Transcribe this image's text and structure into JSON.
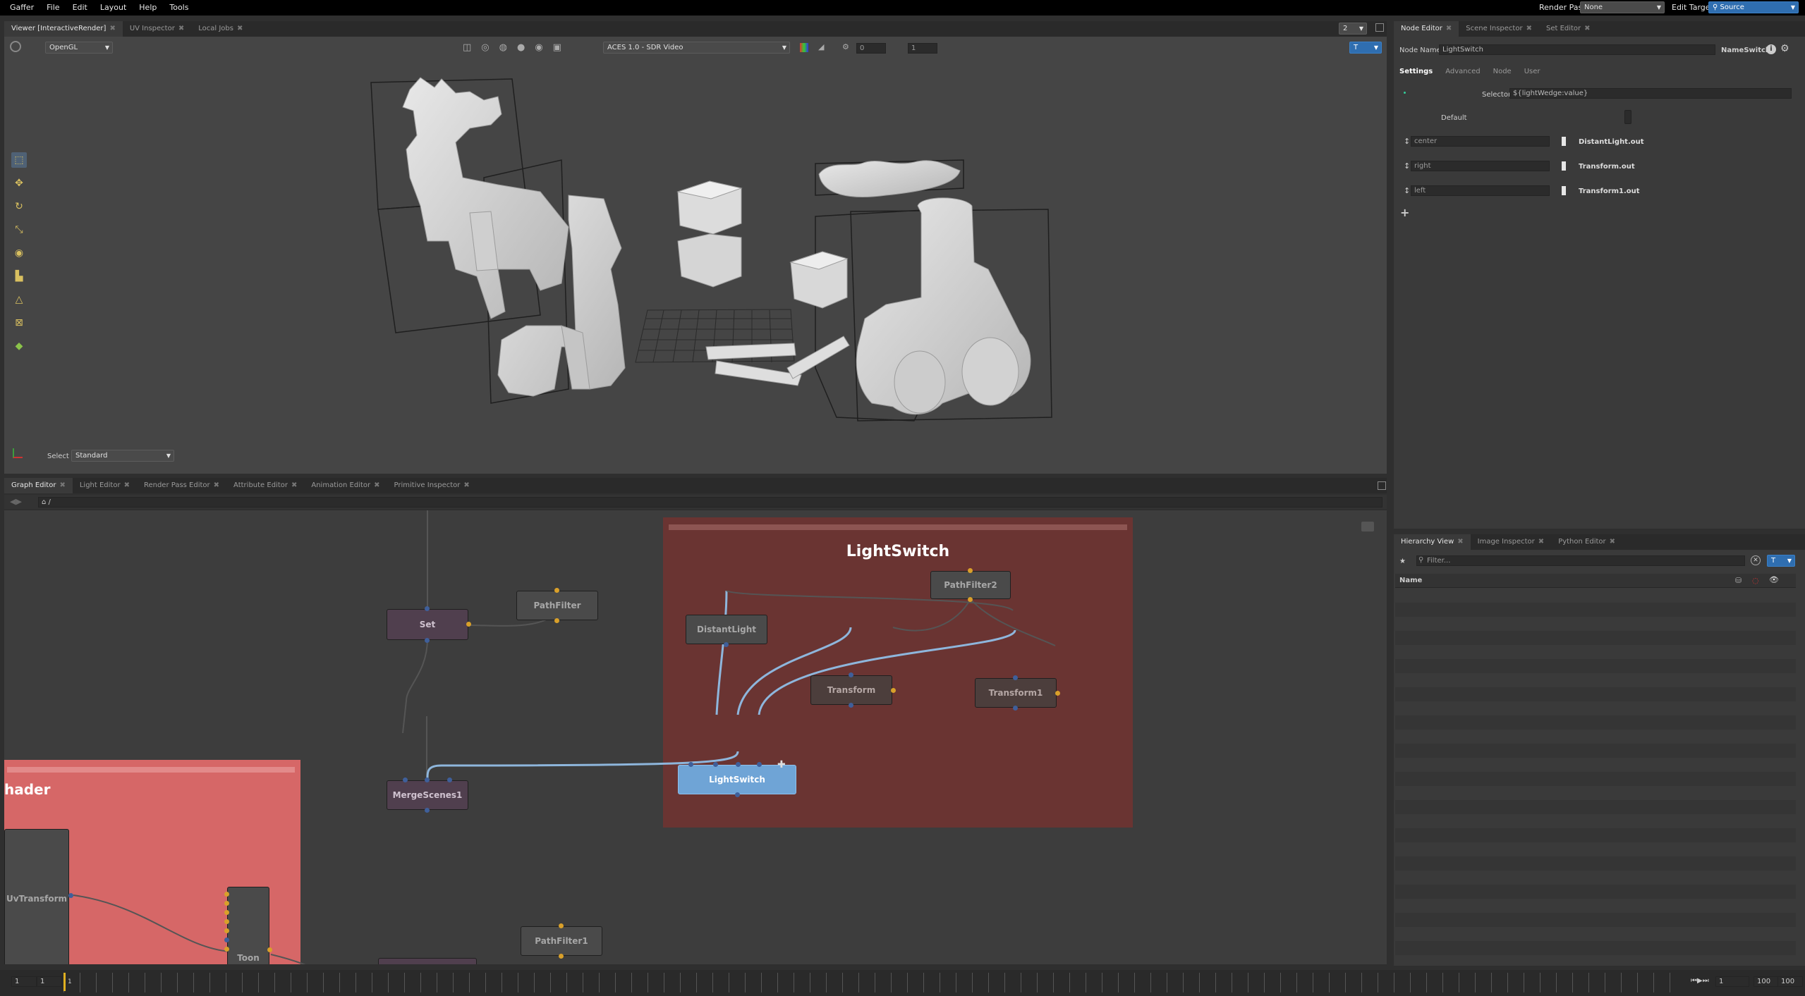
{
  "menubar": {
    "items": [
      "Gaffer",
      "File",
      "Edit",
      "Layout",
      "Help",
      "Tools"
    ],
    "render_pass_label": "Render Pass",
    "render_pass_value": "None",
    "edit_target_label": "Edit Target",
    "edit_target_value": "Source"
  },
  "viewer": {
    "tabs": [
      {
        "label": "Viewer [InteractiveRender]",
        "active": true
      },
      {
        "label": "UV Inspector",
        "active": false
      },
      {
        "label": "Local Jobs",
        "active": false
      }
    ],
    "layout_dropdown": "2",
    "renderer": "OpenGL",
    "display_transform": "ACES 1.0 - SDR Video",
    "exposure": "0",
    "gamma": "1",
    "camera_badge": "T",
    "select_label": "Select",
    "select_mode": "Standard"
  },
  "node_editor": {
    "tabs": [
      {
        "label": "Node Editor",
        "active": true
      },
      {
        "label": "Scene Inspector",
        "active": false
      },
      {
        "label": "Set Editor",
        "active": false
      }
    ],
    "node_name_label": "Node Name",
    "node_name": "LightSwitch",
    "node_type": "NameSwitch",
    "sub_tabs": [
      "Settings",
      "Advanced",
      "Node",
      "User"
    ],
    "selector_label": "Selector",
    "selector_value": "${lightWedge:value}",
    "default_label": "Default",
    "rows": [
      {
        "name": "center",
        "input": "DistantLight.out"
      },
      {
        "name": "right",
        "input": "Transform.out"
      },
      {
        "name": "left",
        "input": "Transform1.out"
      }
    ]
  },
  "hierarchy": {
    "tabs": [
      {
        "label": "Hierarchy View",
        "active": true
      },
      {
        "label": "Image Inspector",
        "active": false
      },
      {
        "label": "Python Editor",
        "active": false
      }
    ],
    "filter_placeholder": "Filter...",
    "column_name": "Name",
    "filter_badge": "T"
  },
  "graph_editor": {
    "tabs": [
      {
        "label": "Graph Editor",
        "active": true
      },
      {
        "label": "Light Editor",
        "active": false
      },
      {
        "label": "Render Pass Editor",
        "active": false
      },
      {
        "label": "Attribute Editor",
        "active": false
      },
      {
        "label": "Animation Editor",
        "active": false
      },
      {
        "label": "Primitive Inspector",
        "active": false
      }
    ],
    "path": "/",
    "backdrop_title": "LightSwitch",
    "backdrop2_title": "hader",
    "nodes": {
      "path_filter_2": "PathFilter2",
      "distant_light": "DistantLight",
      "transform": "Transform",
      "transform1": "Transform1",
      "light_switch": "LightSwitch",
      "path_filter": "PathFilter",
      "set": "Set",
      "merge_scenes": "MergeScenes1",
      "path_filter1": "PathFilter1",
      "uv_transform": "UvTransform",
      "toon": "Toon"
    }
  },
  "timeline": {
    "start": "1",
    "current_start": "1",
    "playhead": "1",
    "frame": "1",
    "end_inner": "100",
    "end": "100"
  }
}
